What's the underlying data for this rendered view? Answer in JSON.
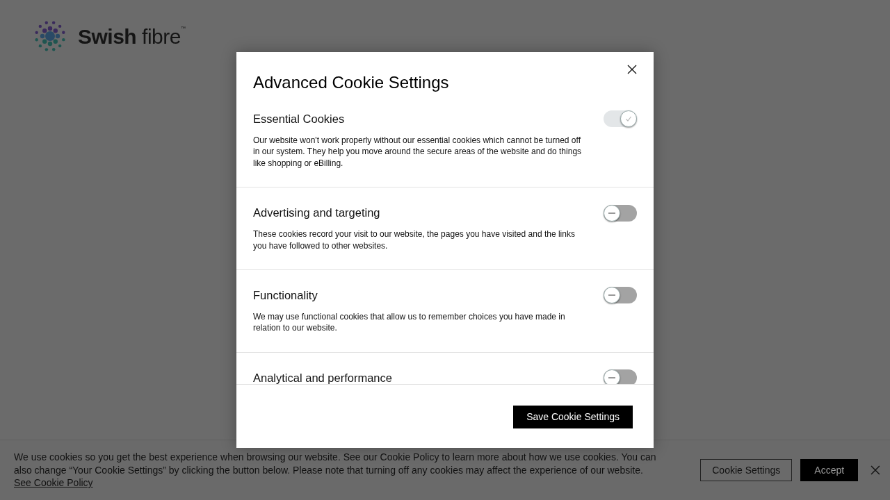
{
  "logo": {
    "text": "Swish fibre",
    "trademark": "™"
  },
  "dialog": {
    "title": "Advanced Cookie Settings",
    "sections": [
      {
        "title": "Essential Cookies",
        "description": "Our website won't work properly without our essential cookies which cannot be turned off in our system. They help you move around the secure areas of the website and do things like shopping or eBilling.",
        "on": true,
        "disabled": true
      },
      {
        "title": "Advertising and targeting",
        "description": "These cookies record your visit to our website, the pages you have visited and the links you have followed to other websites.",
        "on": false,
        "disabled": false
      },
      {
        "title": "Functionality",
        "description": "We may use functional cookies that allow us to remember choices you have made in relation to our website.",
        "on": false,
        "disabled": false
      },
      {
        "title": "Analytical and performance",
        "on": false,
        "disabled": false
      }
    ],
    "save_button": "Save Cookie Settings"
  },
  "banner": {
    "text": "We use cookies so you get the best experience when browsing our website. See our Cookie Policy to learn more about how we use cookies. You can also change “Your Cookie Settings” by clicking the button below. Please note that turning off any cookies may affect the experience of our website.",
    "link": "See Cookie Policy",
    "settings_button": "Cookie Settings",
    "accept_button": "Accept"
  }
}
